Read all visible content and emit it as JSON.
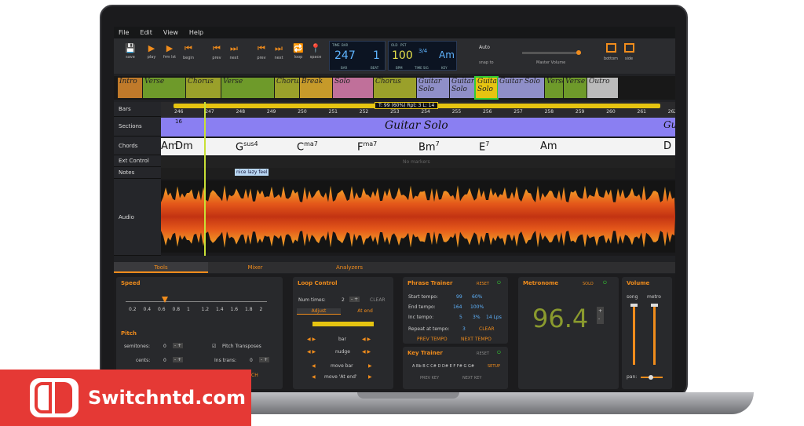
{
  "menu": [
    "File",
    "Edit",
    "View",
    "Help"
  ],
  "toolbar": {
    "save": "save",
    "play": "play",
    "fromlast": "frm lst",
    "begin": "begin",
    "prev1": "prev",
    "next1": "next",
    "prev2": "prev",
    "next2": "next",
    "loop": "loop",
    "space": "space",
    "bar_value": "247",
    "beat_value": "1",
    "bpm_value": "100",
    "time_sig": "3/4",
    "key_value": "Am",
    "bar_label": "BAR",
    "beat_label": "BEAT",
    "bpm_label": "BPM",
    "time_sig_label": "TIME SIG",
    "key_label": "KEY",
    "time_tag": "TIME",
    "bar_tag": "BAR",
    "old_tag": "OLD",
    "pst_tag": "PST",
    "snap_value": "Auto",
    "snap_label": "snap to",
    "master_volume": "Master Volume",
    "bottom": "bottom",
    "side": "side",
    "master_volume_level": 0.95
  },
  "overview_sections": [
    "Intro",
    "Verse",
    "Chorus",
    "Verse",
    "Chorus",
    "Break",
    "Solo",
    "Chorus",
    "Guitar Solo",
    "Guitar Solo",
    "Guitar Solo",
    "Guitar Solo",
    "Verse",
    "Verse",
    "Outro"
  ],
  "tracks": [
    "Bars",
    "Sections",
    "Chords",
    "Ext Control",
    "Notes",
    "Audio"
  ],
  "ruler": [
    "246",
    "247",
    "248",
    "249",
    "250",
    "251",
    "252",
    "253",
    "254",
    "255",
    "256",
    "257",
    "258",
    "259",
    "260",
    "261",
    "262"
  ],
  "loop_info": "T: 99 (60%)  Rpt: 3  L: 14",
  "section_title": "Guitar Solo",
  "section_number": "16",
  "section_side_label": "Gu",
  "chords": [
    {
      "root": "Am",
      "sup": ""
    },
    {
      "root": "Dm",
      "sup": ""
    },
    {
      "root": "G",
      "sup": "sus4"
    },
    {
      "root": "C",
      "sup": "ma7"
    },
    {
      "root": "F",
      "sup": "ma7"
    },
    {
      "root": "Bm",
      "sup": "7"
    },
    {
      "root": "E",
      "sup": "7"
    },
    {
      "root": "Am",
      "sup": ""
    },
    {
      "root": "D",
      "sup": ""
    }
  ],
  "no_markers": "No markers",
  "note_text": "nice lazy feel",
  "tabs": [
    "Tools",
    "Mixer",
    "Analyzers"
  ],
  "speed": {
    "title": "Speed",
    "scale": [
      "0.2",
      "0.4",
      "0.6",
      "0.8",
      "1",
      "1.2",
      "1.4",
      "1.6",
      "1.8",
      "2"
    ]
  },
  "pitch": {
    "title": "Pitch",
    "semitones_label": "semitones:",
    "semitones": "0",
    "cents_label": "cents:",
    "cents": "0",
    "transposes": "Pitch Transposes",
    "ins_trans_label": "Ins trans:",
    "ins_trans": "0",
    "partial": "CH"
  },
  "loop_control": {
    "title": "Loop Control",
    "num_times_label": "Num times:",
    "num_times": "2",
    "clear": "CLEAR",
    "adjust": "Adjust",
    "at_end": "At end",
    "bar": "bar",
    "nudge": "nudge",
    "move_bar": "move bar",
    "move_at_end": "move 'At end'"
  },
  "phrase_trainer": {
    "title": "Phrase Trainer",
    "reset": "RESET",
    "start_label": "Start tempo:",
    "start": "99",
    "start_pct": "60%",
    "end_label": "End tempo:",
    "end": "164",
    "end_pct": "100%",
    "inc_label": "Inc tempo:",
    "inc": "5",
    "inc_pct": "3%",
    "inc_lps": "14 Lps",
    "repeat_label": "Repeat at tempo:",
    "repeat": "3",
    "clear": "CLEAR",
    "prev": "PREV TEMPO",
    "next": "NEXT TEMPO"
  },
  "key_trainer": {
    "title": "Key Trainer",
    "reset": "RESET",
    "keys": "A Bb B C C# D D# E F F# G G#",
    "setup": "SETUP",
    "prev": "PREV KEY",
    "next": "NEXT KEY"
  },
  "metronome": {
    "title": "Metronome",
    "solo": "SOLO",
    "value": "96.4"
  },
  "volume": {
    "title": "Volume",
    "song": "song",
    "metro": "metro",
    "pan": "pan:"
  },
  "watermark": {
    "text": "Switchntd.com"
  },
  "colors": {
    "accent": "#f08c1c",
    "lcd": "#5fb4ff",
    "section": "#8a7ff2",
    "playhead": "#c8e036",
    "watermark": "#e53935"
  }
}
